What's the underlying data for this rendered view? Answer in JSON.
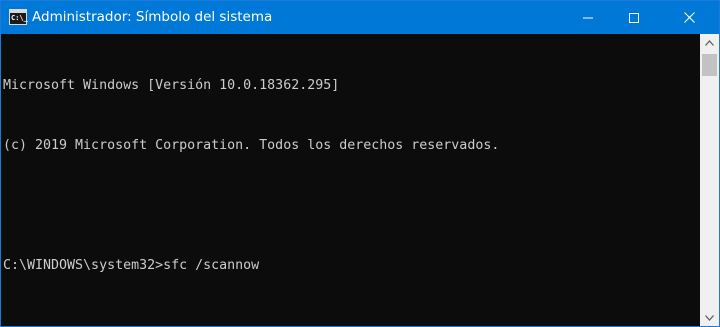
{
  "window": {
    "title": "Administrador: Símbolo del sistema",
    "icon_label": "C:\\_"
  },
  "console": {
    "lines": [
      "Microsoft Windows [Versión 10.0.18362.295]",
      "(c) 2019 Microsoft Corporation. Todos los derechos reservados.",
      "",
      "C:\\WINDOWS\\system32>sfc /scannow"
    ]
  },
  "colors": {
    "titlebar": "#0078d7",
    "console_background": "#0c0c0c",
    "console_text": "#cccccc",
    "scrollbar_track": "#f0f0f0",
    "scrollbar_thumb": "#c2c2c2"
  },
  "icons": {
    "minimize": "minimize-icon",
    "maximize": "maximize-icon",
    "close": "close-icon",
    "scroll_up": "chevron-up-icon",
    "scroll_down": "chevron-down-icon"
  }
}
